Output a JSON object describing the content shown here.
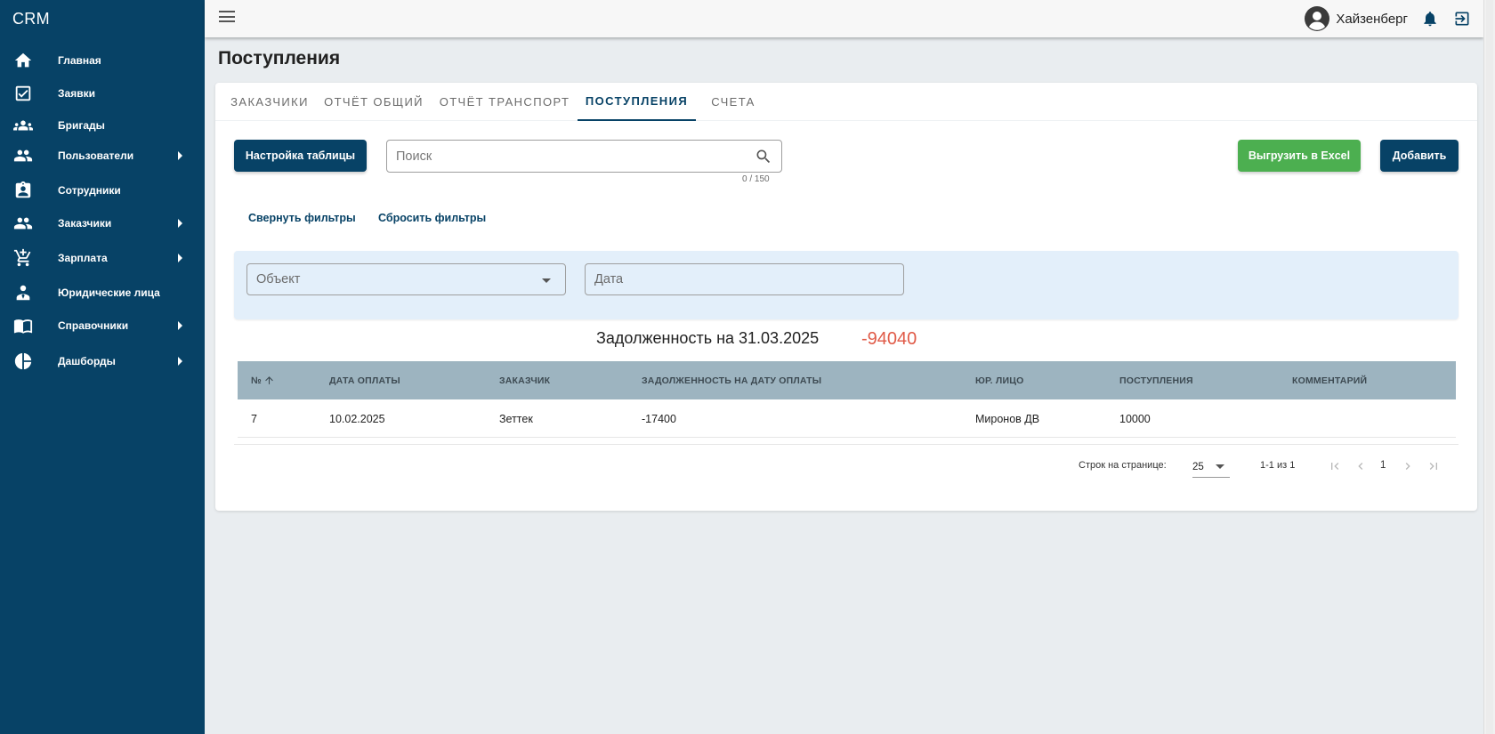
{
  "app": {
    "brand": "CRM"
  },
  "sidebar": {
    "items": [
      {
        "label": "Главная",
        "icon": "home-icon",
        "has_submenu": false
      },
      {
        "label": "Заявки",
        "icon": "checkbox-icon",
        "has_submenu": false
      },
      {
        "label": "Бригады",
        "icon": "group-icon",
        "has_submenu": false
      },
      {
        "label": "Пользователи",
        "icon": "people-icon",
        "has_submenu": true
      },
      {
        "label": "Сотрудники",
        "icon": "badge-icon",
        "has_submenu": false
      },
      {
        "label": "Заказчики",
        "icon": "people-icon",
        "has_submenu": true
      },
      {
        "label": "Зарплата",
        "icon": "cart-icon",
        "has_submenu": true
      },
      {
        "label": "Юридические лица",
        "icon": "person-tie-icon",
        "has_submenu": false
      },
      {
        "label": "Справочники",
        "icon": "book-icon",
        "has_submenu": true
      },
      {
        "label": "Дашборды",
        "icon": "pie-chart-icon",
        "has_submenu": true
      }
    ]
  },
  "topbar": {
    "user_name": "Хайзенберг"
  },
  "page": {
    "title": "Поступления"
  },
  "tabs": [
    {
      "label": "ЗАКАЗЧИКИ",
      "active": false
    },
    {
      "label": "ОТЧЁТ ОБЩИЙ",
      "active": false
    },
    {
      "label": "ОТЧЁТ ТРАНСПОРТ",
      "active": false
    },
    {
      "label": "ПОСТУПЛЕНИЯ",
      "active": true
    },
    {
      "label": "СЧЕТА",
      "active": false
    }
  ],
  "toolbar": {
    "table_settings": "Настройка таблицы",
    "search_placeholder": "Поиск",
    "search_value": "",
    "search_counter": "0 / 150",
    "export_excel": "Выгрузить в Excel",
    "add": "Добавить"
  },
  "filters": {
    "collapse": "Свернуть фильтры",
    "reset": "Сбросить фильтры",
    "object_placeholder": "Объект",
    "date_placeholder": "Дата"
  },
  "summary": {
    "label": "Задолженность на 31.03.2025",
    "value": "-94040"
  },
  "table": {
    "headers": [
      "№",
      "ДАТА ОПЛАТЫ",
      "ЗАКАЗЧИК",
      "ЗАДОЛЖЕННОСТЬ НА ДАТУ ОПЛАТЫ",
      "ЮР. ЛИЦО",
      "ПОСТУПЛЕНИЯ",
      "КОММЕНТАРИЙ"
    ],
    "rows": [
      [
        "7",
        "10.02.2025",
        "Зеттек",
        "-17400",
        "Миронов ДВ",
        "10000",
        ""
      ]
    ]
  },
  "pagination": {
    "rows_per_page_label": "Строк на странице:",
    "rows_per_page": "25",
    "range": "1-1 из 1",
    "current_page": "1"
  },
  "colors": {
    "sidebar_bg": "#074266",
    "accent": "#074266",
    "export_green": "#4caf50",
    "debt_red": "#e05a47",
    "table_header_bg": "#9db4c0",
    "filter_bg": "#e3effa"
  }
}
